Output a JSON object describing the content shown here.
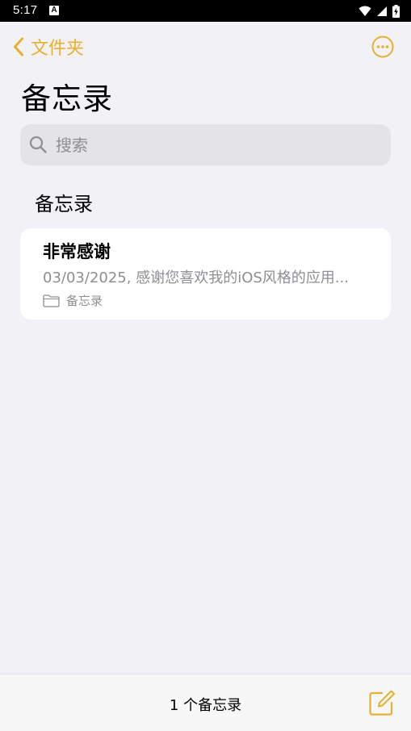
{
  "status_bar": {
    "time": "5:17",
    "notification_icon": "a-icon",
    "icons": [
      "wifi-icon",
      "signal-icon",
      "battery-charging-icon"
    ]
  },
  "nav": {
    "back_label": "文件夹",
    "back_icon": "chevron-left-icon",
    "more_icon": "ellipsis-circle-icon"
  },
  "page": {
    "title": "备忘录"
  },
  "search": {
    "placeholder": "搜索",
    "value": ""
  },
  "section": {
    "header": "备忘录"
  },
  "notes": [
    {
      "title": "非常感谢",
      "preview": "03/03/2025, 感谢您喜欢我的iOS风格的应用...",
      "folder": "备忘录",
      "folder_icon": "folder-icon"
    }
  ],
  "footer": {
    "count_label": "1 个备忘录",
    "compose_icon": "compose-icon"
  },
  "colors": {
    "accent": "#e5b12e",
    "background": "#f2f1f6",
    "secondary_text": "#8e8e93",
    "search_bg": "#e3e3e8"
  }
}
